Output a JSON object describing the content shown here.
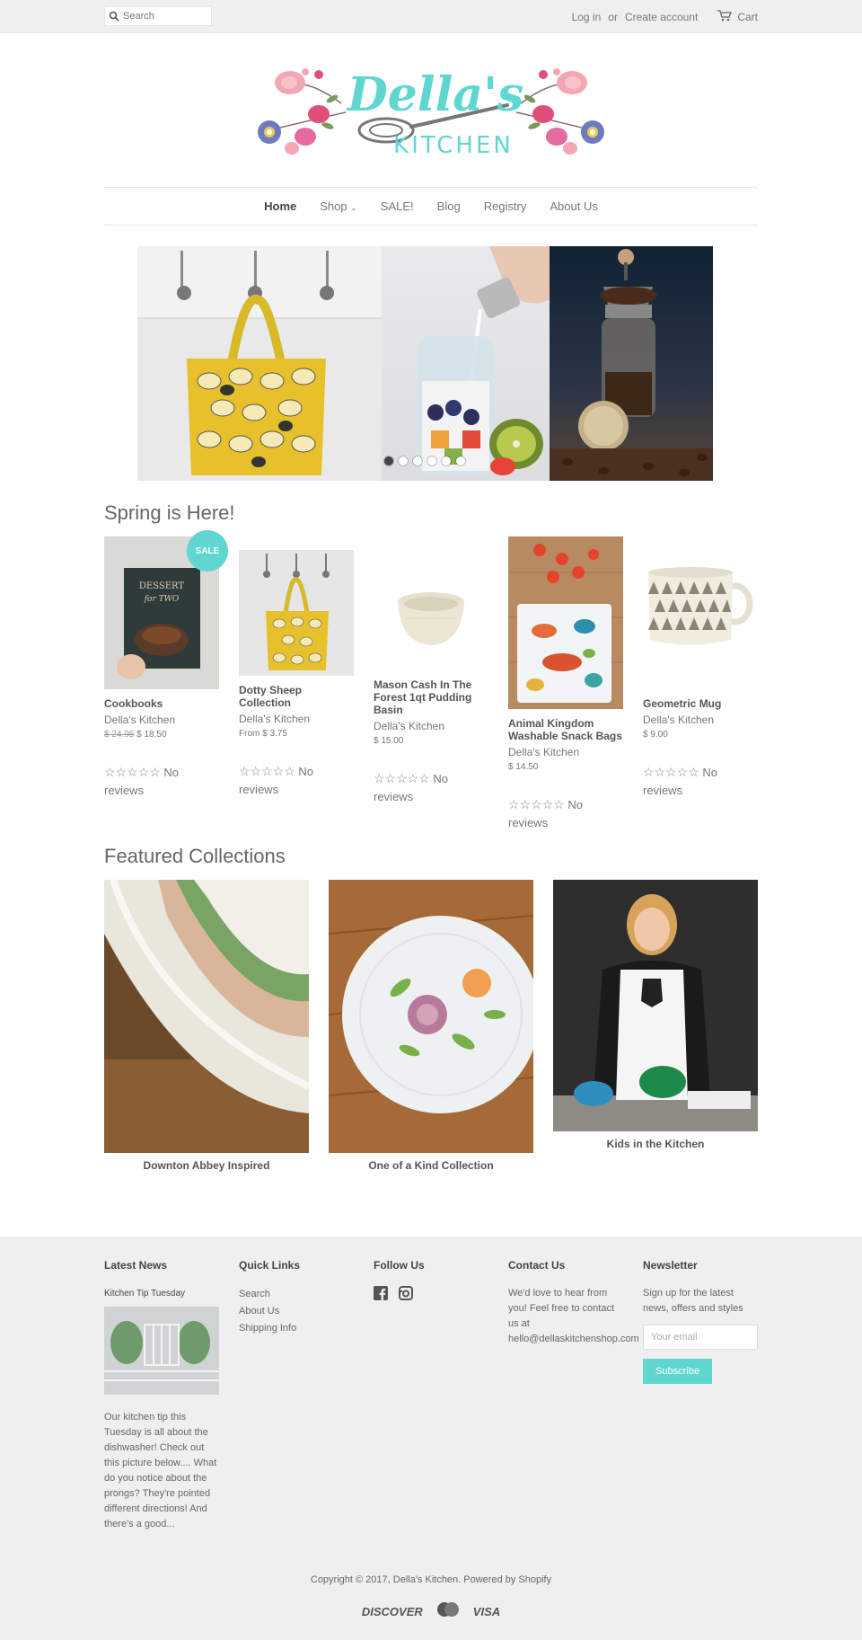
{
  "topbar": {
    "search_placeholder": "Search",
    "login": "Log in",
    "or": "or",
    "create_account": "Create account",
    "cart": "Cart"
  },
  "brand": {
    "name": "Della's",
    "subtitle": "KITCHEN",
    "accent": "#5fd7d0"
  },
  "nav": {
    "home": "Home",
    "shop": "Shop",
    "sale": "SALE!",
    "blog": "Blog",
    "registry": "Registry",
    "about": "About Us"
  },
  "slideshow": {
    "count": 6,
    "active": 0
  },
  "spring": {
    "title": "Spring is Here!",
    "products": [
      {
        "title": "Cookbooks",
        "vendor": "Della's Kitchen",
        "price_old": "$ 24.95",
        "price": "$ 18.50",
        "badge": "SALE",
        "reviews": "No reviews"
      },
      {
        "title": "Dotty Sheep Collection",
        "vendor": "Della's Kitchen",
        "price": "From $ 3.75",
        "reviews": "No reviews"
      },
      {
        "title": "Mason Cash In The Forest 1qt Pudding Basin",
        "vendor": "Della's Kitchen",
        "price": "$ 15.00",
        "reviews": "No reviews"
      },
      {
        "title": "Animal Kingdom Washable Snack Bags",
        "vendor": "Della's Kitchen",
        "price": "$ 14.50",
        "reviews": "No reviews"
      },
      {
        "title": "Geometric Mug",
        "vendor": "Della's Kitchen",
        "price": "$ 9.00",
        "reviews": "No reviews"
      }
    ],
    "stars": "☆☆☆☆☆"
  },
  "featured": {
    "title": "Featured Collections",
    "collections": [
      {
        "title": "Downton Abbey Inspired"
      },
      {
        "title": "One of a Kind Collection"
      },
      {
        "title": "Kids in the Kitchen"
      }
    ]
  },
  "footer": {
    "news": {
      "heading": "Latest News",
      "post_title": "Kitchen Tip Tuesday",
      "excerpt": "Our kitchen tip this Tuesday is all about the dishwasher!  Check out this picture below.... What do you notice about the prongs? They're pointed different directions!  And there's a good..."
    },
    "quick_links": {
      "heading": "Quick Links",
      "items": [
        "Search",
        "About Us",
        "Shipping Info"
      ]
    },
    "follow": {
      "heading": "Follow Us"
    },
    "contact": {
      "heading": "Contact Us",
      "text": "We'd love to hear from you! Feel free to contact us at hello@dellaskitchenshop.com"
    },
    "newsletter": {
      "heading": "Newsletter",
      "text": "Sign up for the latest news, offers and styles",
      "placeholder": "Your email",
      "button": "Subscribe"
    },
    "copyright": "Copyright © 2017, Della's Kitchen. Powered by Shopify",
    "payments": [
      "DISCOVER",
      "VISA"
    ]
  }
}
